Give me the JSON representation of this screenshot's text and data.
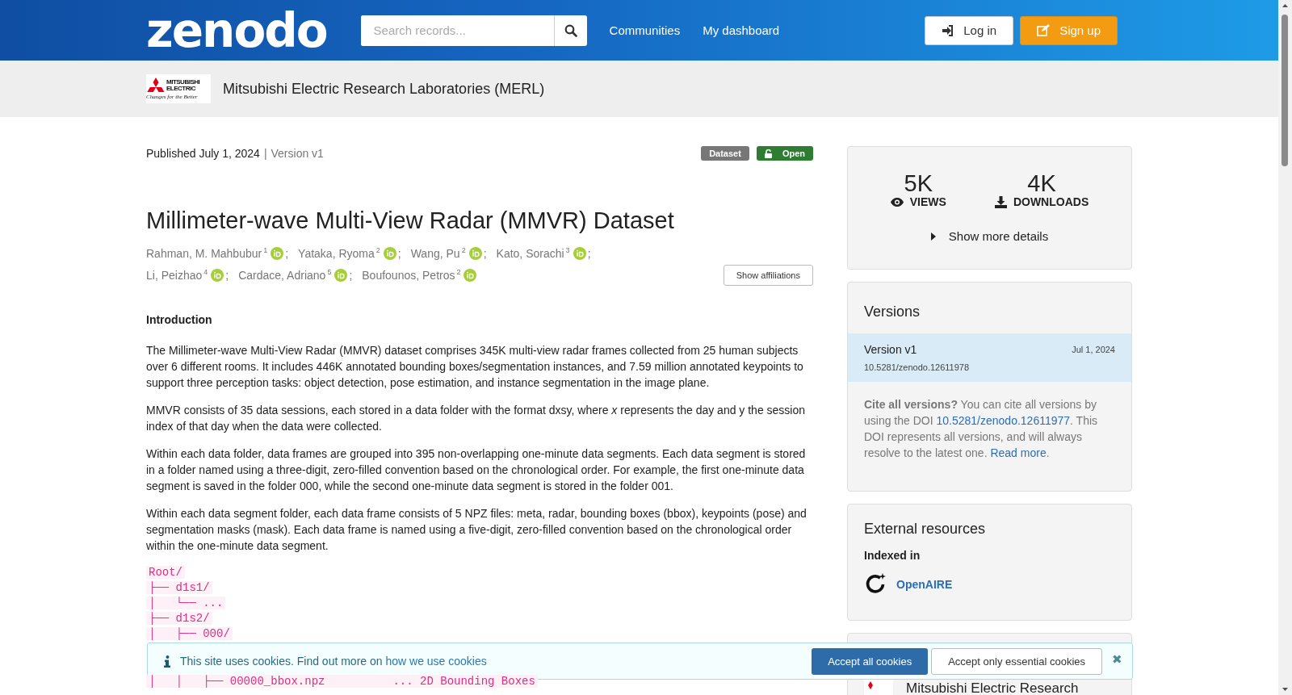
{
  "header": {
    "logo": "zenodo",
    "search": {
      "placeholder": "Search records..."
    },
    "nav": [
      "Communities",
      "My dashboard"
    ],
    "login": "Log in",
    "signup": "Sign up"
  },
  "community": {
    "logo_lines": [
      "MITSUBISHI",
      "ELECTRIC"
    ],
    "logo_tagline": "Changes for the Better",
    "name": "Mitsubishi Electric Research Laboratories (MERL)"
  },
  "record": {
    "published": "Published July 1, 2024",
    "separator": "|",
    "version": "Version v1",
    "badges": [
      {
        "label": "Dataset",
        "color": "#777777",
        "kind": "type"
      },
      {
        "label": "Open",
        "color": "#2e7d32",
        "kind": "access"
      }
    ],
    "title": "Millimeter-wave Multi-View Radar (MMVR) Dataset",
    "authors": [
      [
        {
          "name": "Rahman, M. Mahbubur",
          "affiliation": "1",
          "separator": ";"
        },
        {
          "name": "Yataka, Ryoma",
          "affiliation": "2",
          "separator": ";"
        },
        {
          "name": "Wang, Pu",
          "affiliation": "2",
          "separator": ";"
        },
        {
          "name": "Kato, Sorachi",
          "affiliation": "3",
          "separator": ";"
        }
      ],
      [
        {
          "name": "Li, Peizhao",
          "affiliation": "4",
          "separator": ";"
        },
        {
          "name": "Cardace, Adriano",
          "affiliation": "5",
          "separator": ";"
        },
        {
          "name": "Boufounos, Petros",
          "affiliation": "2"
        }
      ]
    ],
    "show_affiliations": "Show affiliations",
    "section": "Introduction",
    "paragraphs": [
      "The Millimeter-wave Multi-View Radar (MMVR) dataset comprises 345K multi-view radar frames collected from 25 human subjects over 6 different rooms. It includes 446K annotated bounding boxes/segmentation instances, and 7.59 million annotated keypoints to support three perception tasks: object detection, pose estimation, and instance segmentation in the image plane.",
      "MMVR consists of 35 data sessions, each stored in a data folder with the format dxsy, where *x* represents the day and y the session index of that day when the data were collected.",
      "Within each data folder, data frames are grouped into 395 non-overlapping one-minute data segments. Each data segment is stored in a folder named using a three-digit, zero-filled convention based on the chronological order. For example, the first one-minute data segment is saved in the folder 000, while the second one-minute data segment is stored in the folder 001.",
      "Within each data segment folder, each data frame consists of 5 NPZ files: meta, radar, bounding boxes (bbox), keypoints (pose) and segmentation masks (mask). Each data frame is named using a five-digit, zero-filled convention based on the chronological order within the one-minute data segment."
    ],
    "code": [
      {
        "text": "Root/"
      },
      {
        "text": "├── d1s1/"
      },
      {
        "text": "│   └── ..."
      },
      {
        "text": "├── d1s2/"
      },
      {
        "text": "│   ├── 000/"
      },
      {
        "text": "│   │   ├── 00000_bbox.npz          ... 2D Bounding Boxes"
      }
    ]
  },
  "stats": [
    {
      "value": "5K",
      "label": "VIEWS",
      "kind": "views"
    },
    {
      "value": "4K",
      "label": "DOWNLOADS",
      "kind": "downloads"
    }
  ],
  "show_more": "Show more details",
  "versions": {
    "title": "Versions",
    "items": [
      {
        "label": "Version v1",
        "date": "Jul 1, 2024",
        "doi": "10.5281/zenodo.12611978",
        "selected": true
      }
    ],
    "cite_bold": "Cite all versions?",
    "cite_a": "You can cite all versions by using the DOI",
    "cite_doi": "10.5281/zenodo.12611977",
    "cite_b": ". This DOI represents all versions, and will always resolve to the latest one.",
    "read_more": "Read more",
    "cite_end": "."
  },
  "external": {
    "title": "External resources",
    "subtitle": "Indexed in",
    "link": "OpenAIRE"
  },
  "community_card": {
    "name": "Mitsubishi Electric Research"
  },
  "cookies": {
    "text": "This site uses cookies. Find out more on",
    "link": "how we use cookies",
    "accept_all": "Accept all cookies",
    "accept_essential": "Accept only essential cookies",
    "close": "✖"
  }
}
